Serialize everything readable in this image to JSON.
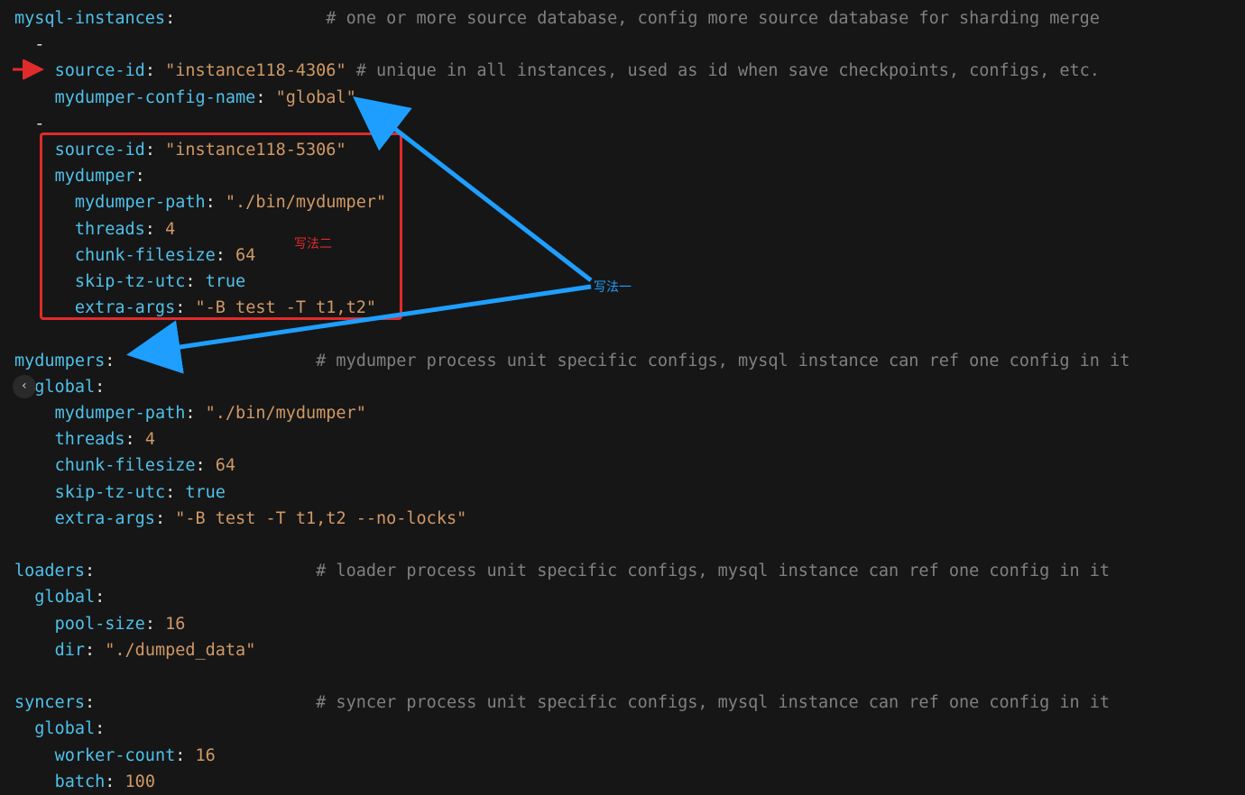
{
  "lines": {
    "mysql_instances_k": "mysql-instances",
    "colon": ":",
    "mysql_instances_c": "# one or more source database, config more source database for sharding merge",
    "dash": "-",
    "inst1_src_k": "source-id",
    "inst1_src_v": "\"instance118-4306\"",
    "inst1_src_c": "# unique in all instances, used as id when save checkpoints, configs, etc.",
    "inst1_mdc_k": "mydumper-config-name",
    "inst1_mdc_v": "\"global\"",
    "inst2_src_k": "source-id",
    "inst2_src_v": "\"instance118-5306\"",
    "inst2_md_k": "mydumper",
    "inst2_mdpath_k": "mydumper-path",
    "inst2_mdpath_v": "\"./bin/mydumper\"",
    "inst2_threads_k": "threads",
    "inst2_threads_v": "4",
    "inst2_chunk_k": "chunk-filesize",
    "inst2_chunk_v": "64",
    "inst2_skip_k": "skip-tz-utc",
    "inst2_skip_v": "true",
    "inst2_extra_k": "extra-args",
    "inst2_extra_v": "\"-B test -T t1,t2\"",
    "mydumpers_k": "mydumpers",
    "mydumpers_c": "# mydumper process unit specific configs, mysql instance can ref one config in it",
    "md_global_k": "global",
    "md_mdpath_k": "mydumper-path",
    "md_mdpath_v": "\"./bin/mydumper\"",
    "md_threads_k": "threads",
    "md_threads_v": "4",
    "md_chunk_k": "chunk-filesize",
    "md_chunk_v": "64",
    "md_skip_k": "skip-tz-utc",
    "md_skip_v": "true",
    "md_extra_k": "extra-args",
    "md_extra_v": "\"-B test -T t1,t2 --no-locks\"",
    "loaders_k": "loaders",
    "loaders_c": "# loader process unit specific configs, mysql instance can ref one config in it",
    "ld_global_k": "global",
    "ld_pool_k": "pool-size",
    "ld_pool_v": "16",
    "ld_dir_k": "dir",
    "ld_dir_v": "\"./dumped_data\"",
    "syncers_k": "syncers",
    "syncers_c": "# syncer process unit specific configs, mysql instance can ref one config in it",
    "sy_global_k": "global",
    "sy_worker_k": "worker-count",
    "sy_worker_v": "16",
    "sy_batch_k": "batch",
    "sy_batch_v": "100"
  },
  "annotations": {
    "label_method2": "写法二",
    "label_method1": "写法一",
    "chevron": "‹"
  }
}
